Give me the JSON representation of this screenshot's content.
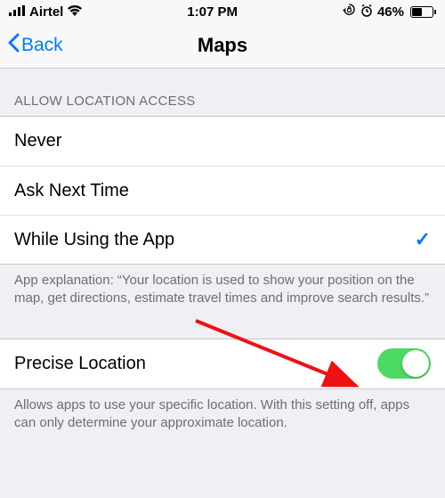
{
  "status_bar": {
    "carrier": "Airtel",
    "time": "1:07 PM",
    "battery_percent": "46%"
  },
  "nav": {
    "back_label": "Back",
    "title": "Maps"
  },
  "section_header": "ALLOW LOCATION ACCESS",
  "options": [
    {
      "label": "Never"
    },
    {
      "label": "Ask Next Time"
    },
    {
      "label": "While Using the App",
      "selected": true
    }
  ],
  "explanation": "App explanation: “Your location is used to show your position on the map, get directions, estimate travel times and improve search results.”",
  "precise": {
    "label": "Precise Location",
    "on": true
  },
  "precise_footer": "Allows apps to use your specific location. With this setting off, apps can only determine your approximate location."
}
